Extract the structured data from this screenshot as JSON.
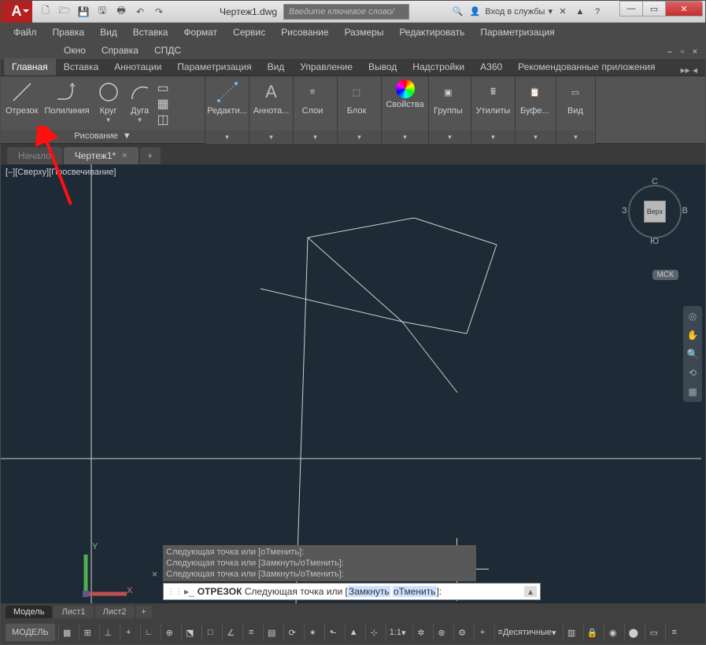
{
  "titlebar": {
    "doc": "Чертеж1.dwg",
    "search_ph": "Введите ключевое слово/фразу",
    "login": "Вход в службы"
  },
  "menus": {
    "row1": [
      "Файл",
      "Правка",
      "Вид",
      "Вставка",
      "Формат",
      "Сервис",
      "Рисование",
      "Размеры",
      "Редактировать",
      "Параметризация"
    ],
    "row2": [
      "Окно",
      "Справка",
      "СПДС"
    ]
  },
  "rtabs": [
    "Главная",
    "Вставка",
    "Аннотации",
    "Параметризация",
    "Вид",
    "Управление",
    "Вывод",
    "Надстройки",
    "A360",
    "Рекомендованные приложения"
  ],
  "draw": {
    "line": "Отрезок",
    "pline": "Полилиния",
    "circle": "Круг",
    "arc": "Дуга",
    "panel": "Рисование"
  },
  "panels": {
    "edit": "Редакти...",
    "annot": "Аннота...",
    "layers": "Слои",
    "block": "Блок",
    "props": "Свойства",
    "groups": "Группы",
    "util": "Утилиты",
    "clip": "Буфе...",
    "view": "Вид"
  },
  "ftabs": {
    "start": "Начало",
    "doc": "Чертеж1*"
  },
  "view_label": "[–][Сверху][Просвечивание]",
  "viewcube": {
    "top": "Верх",
    "n": "С",
    "s": "Ю",
    "e": "В",
    "w": "З",
    "wcs": "МСК"
  },
  "axis": {
    "x": "X",
    "y": "Y"
  },
  "cmd_hist": [
    "Следующая точка или [оТменить]:",
    "Следующая точка или [Замкнуть/оТменить]:",
    "Следующая точка или [Замкнуть/оТменить]:"
  ],
  "cmd": {
    "cmd": "ОТРЕЗОК",
    "text": " Следующая точка или [",
    "o1": "Замкнуть",
    "o2": "оТменить",
    "end": "]:"
  },
  "ltabs": {
    "model": "Модель",
    "l1": "Лист1",
    "l2": "Лист2"
  },
  "status": {
    "model": "МОДЕЛЬ",
    "scale": "1:1",
    "units": "Десятичные"
  }
}
